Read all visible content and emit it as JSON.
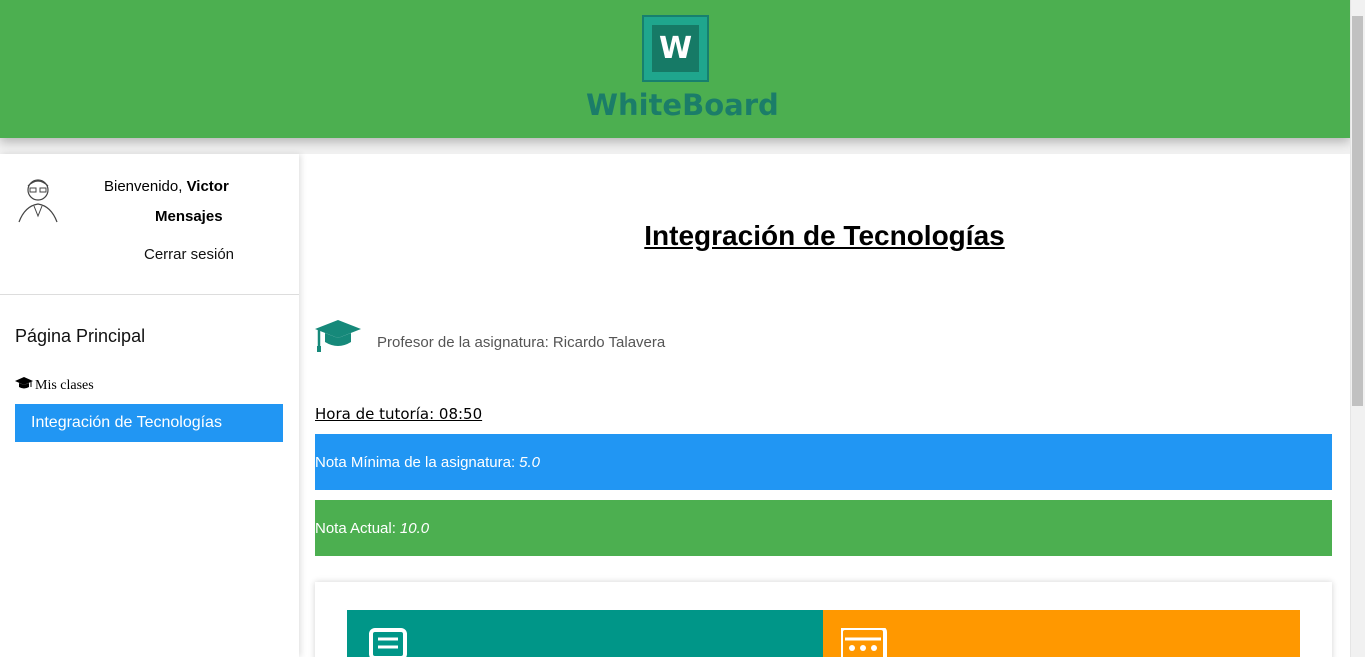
{
  "header": {
    "logo_letter": "W",
    "brand": "WhiteBoard",
    "bg_color": "#4caf50",
    "brand_color": "#1b7d69"
  },
  "sidebar": {
    "welcome_prefix": "Bienvenido, ",
    "user_name": "Victor",
    "messages": "Mensajes",
    "logout": "Cerrar sesión",
    "home": "Página Principal",
    "classes_label": "Mis clases",
    "classes": [
      {
        "label": "Integración de Tecnologías",
        "active": true
      }
    ]
  },
  "main": {
    "title": "Integración de Tecnologías",
    "professor": "Profesor de la asignatura: Ricardo Talavera",
    "tutoria": "Hora de tutoría: 08:50",
    "min_grade_label": "Nota Mínima de la asignatura:",
    "min_grade_value": "5.0",
    "current_grade_label": "Nota Actual:",
    "current_grade_value": "10.0"
  },
  "colors": {
    "blue": "#2196f3",
    "green": "#4caf50",
    "teal": "#009688",
    "orange": "#ff9800"
  },
  "icons": [
    "graduation-cap-icon",
    "book-icon",
    "calculator-icon",
    "avatar-icon"
  ]
}
